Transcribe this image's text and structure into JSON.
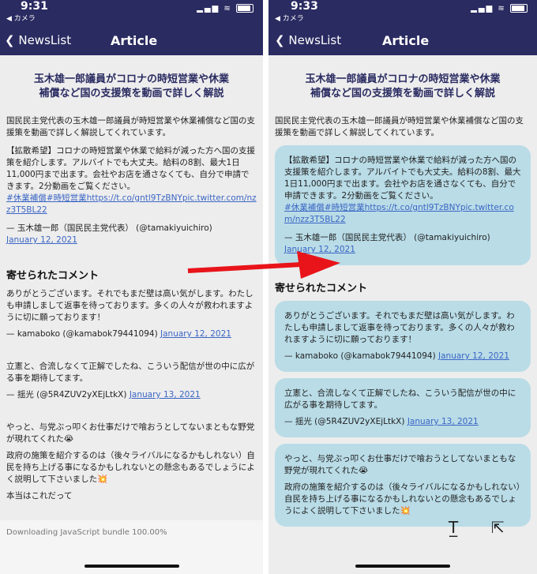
{
  "left": {
    "time": "9:31",
    "back_app": "◀ カメラ",
    "nav_back": "NewsList",
    "nav_title": "Article",
    "title_line1": "玉木雄一郎議員がコロナの時短営業や休業",
    "title_line2": "補償など国の支援策を動画で詳しく解説",
    "intro": "国民民主党代表の玉木雄一郎議員が時短営業や休業補償など国の支援策を動画で詳しく解説してくれています。",
    "quote_text": "【拡散希望】コロナの時短営業や休業で給料が減った方へ国の支援策を紹介します。アルバイトでも大丈夫。給料の8割、最大1日11,000円まで出ます。会社やお店を通さなくても、自分で申請できます。2分動画をご覧ください。",
    "quote_link": "#休業補償#時短営業https://t.co/gntl9TzBNYpic.twitter.com/nzz3T5BL22",
    "quote_author": "— 玉木雄一郎（国民民主党代表） (@tamakiyuichiro)",
    "quote_date": "January 12, 2021",
    "section_title": "寄せられたコメント",
    "c1_text": "ありがとうございます。それでもまだ壁は高い気がします。わたしも申請しまして返事を待っております。多くの人々が救われますように切に願っております！",
    "c1_author": "— kamaboko (@kamabok79441094)",
    "c1_date": "January 12, 2021",
    "c2_text": "立憲と、合流しなくて正解でしたね、こういう配信が世の中に広がる事を期待してます。",
    "c2_author": "— 揺光 (@5R4ZUV2yXEjLtkX)",
    "c2_date": "January 13, 2021",
    "c3_text": "やっと、与党ぶっ叩くお仕事だけで喰おうとしてないまともな野党が現れてくれた😭",
    "c3_text2": "政府の施策を紹介するのは（後々ライバルになるかもしれない）自民を持ち上げる事になるかもしれないとの懸念もあるでしょうによく説明して下さいました💥",
    "c3_text3": "本当はこれだって",
    "download_status": "Downloading JavaScript bundle 100.00%"
  },
  "right": {
    "time": "9:33",
    "back_app": "◀ カメラ",
    "nav_back": "NewsList",
    "nav_title": "Article"
  },
  "colors": {
    "header": "#2a2b61",
    "link": "#3b66c4",
    "card": "#b9dce7",
    "arrow": "#e8141a"
  },
  "icons": {
    "back": "chevron-left-icon",
    "font_size": "text-size-icon",
    "share": "share-icon"
  }
}
